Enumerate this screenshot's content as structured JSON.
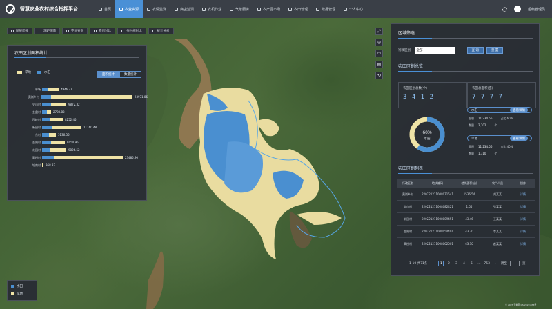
{
  "header": {
    "app_title": "智慧农业农村综合指挥平台",
    "nav": [
      {
        "label": "首页",
        "active": false
      },
      {
        "label": "农业资源",
        "active": true
      },
      {
        "label": "农情监测",
        "active": false
      },
      {
        "label": "病虫监测",
        "active": false
      },
      {
        "label": "农机作业",
        "active": false
      },
      {
        "label": "气象服务",
        "active": false
      },
      {
        "label": "农产品市场",
        "active": false
      },
      {
        "label": "农田管理",
        "active": false
      },
      {
        "label": "数据管理",
        "active": false
      },
      {
        "label": "个人中心",
        "active": false
      }
    ],
    "user_label": "超级管理员"
  },
  "toolbar": [
    "图层切换",
    "测距测面",
    "空间查询",
    "卷帘对比",
    "多时相对比",
    "统计分析"
  ],
  "map_tools": [
    "⤢",
    "◎",
    "▭",
    "▤",
    "⟲"
  ],
  "left_panel": {
    "title": "农田区划面积统计",
    "legend": [
      {
        "label": "旱地",
        "color": "#efe3a6"
      },
      {
        "label": "水田",
        "color": "#4a8fd0"
      }
    ],
    "toggle": [
      "面积统计",
      "数量统计"
    ],
    "toggle_selected": 0,
    "rows": [
      {
        "label": "林场",
        "a": 9,
        "b": 15,
        "value": "4946.77"
      },
      {
        "label": "黄岗乡村",
        "a": 15,
        "b": 118,
        "value": "23971.86"
      },
      {
        "label": "尖山村",
        "a": 13,
        "b": 22,
        "value": "9872.32"
      },
      {
        "label": "金盘村",
        "a": 7,
        "b": 6,
        "value": "2780.88"
      },
      {
        "label": "西岭村",
        "a": 12,
        "b": 18,
        "value": "8252.45"
      },
      {
        "label": "新田村",
        "a": 15,
        "b": 42,
        "value": "11160.48"
      },
      {
        "label": "东村",
        "a": 10,
        "b": 10,
        "value": "5136.56"
      },
      {
        "label": "金阳村",
        "a": 13,
        "b": 20,
        "value": "8454.96"
      },
      {
        "label": "花园村",
        "a": 11,
        "b": 24,
        "value": "9826.52"
      },
      {
        "label": "高桥村",
        "a": 17,
        "b": 100,
        "value": "23485.90"
      },
      {
        "label": "城南村",
        "a": 0,
        "b": 2,
        "value": "368.87"
      }
    ]
  },
  "right_panel": {
    "filter_title": "区域筛选",
    "filter_label": "行政区划:",
    "filter_value": "全部",
    "btn_query": "查 询",
    "btn_reset": "重 置",
    "overview_title": "农田区划总览",
    "stat1_label": "农田区划总数(个)",
    "stat1_value": "3 4 1 2",
    "stat2_label": "农田总面积(亩)",
    "stat2_value": "7 7 7 7",
    "donut_pct": "60%",
    "donut_sub": "水田",
    "donut_ratio": 0.6,
    "pill1": {
      "label": "水田",
      "btn": "查看详情"
    },
    "pill1_kv": [
      {
        "k": "面积",
        "v": "11,234.56",
        "t": "占比 60%"
      },
      {
        "k": "数量",
        "v": "2,102",
        "t": "个"
      }
    ],
    "pill2": {
      "label": "旱地",
      "btn": "查看详情"
    },
    "pill2_kv": [
      {
        "k": "面积",
        "v": "11,234.56",
        "t": "占比 40%"
      },
      {
        "k": "数量",
        "v": "1,310",
        "t": "个"
      }
    ],
    "list_title": "农田区划列表",
    "table_headers": [
      "行政区划",
      "地块编码",
      "地块面积(亩)",
      "农户人员",
      "操作"
    ],
    "table_rows": [
      [
        "黄岗乡村",
        "220221211008071541",
        "1536.54",
        "刘某某",
        "详情"
      ],
      [
        "尖山村",
        "220221211008082421",
        "1.55",
        "张某某",
        "详情"
      ],
      [
        "新田村",
        "220221211008009451",
        "43.46",
        "王某某",
        "详情"
      ],
      [
        "金阳村",
        "220221211008054401",
        "43.70",
        "李某某",
        "详情"
      ],
      [
        "高桥村",
        "220221211008062001",
        "43.70",
        "赵某某",
        "详情"
      ]
    ],
    "pager": {
      "summary": "1-10 共71条",
      "pages": [
        "1",
        "2",
        "3",
        "4",
        "5",
        "...",
        "753"
      ],
      "current": "1",
      "goto_label": "跳至",
      "page_unit": "页"
    }
  },
  "map_legend": [
    {
      "label": "水田",
      "color": "#4a8fd0"
    },
    {
      "label": "旱地",
      "color": "#efe3a6"
    }
  ],
  "copyright": "© 2023 天地图 GS(2023)336号"
}
